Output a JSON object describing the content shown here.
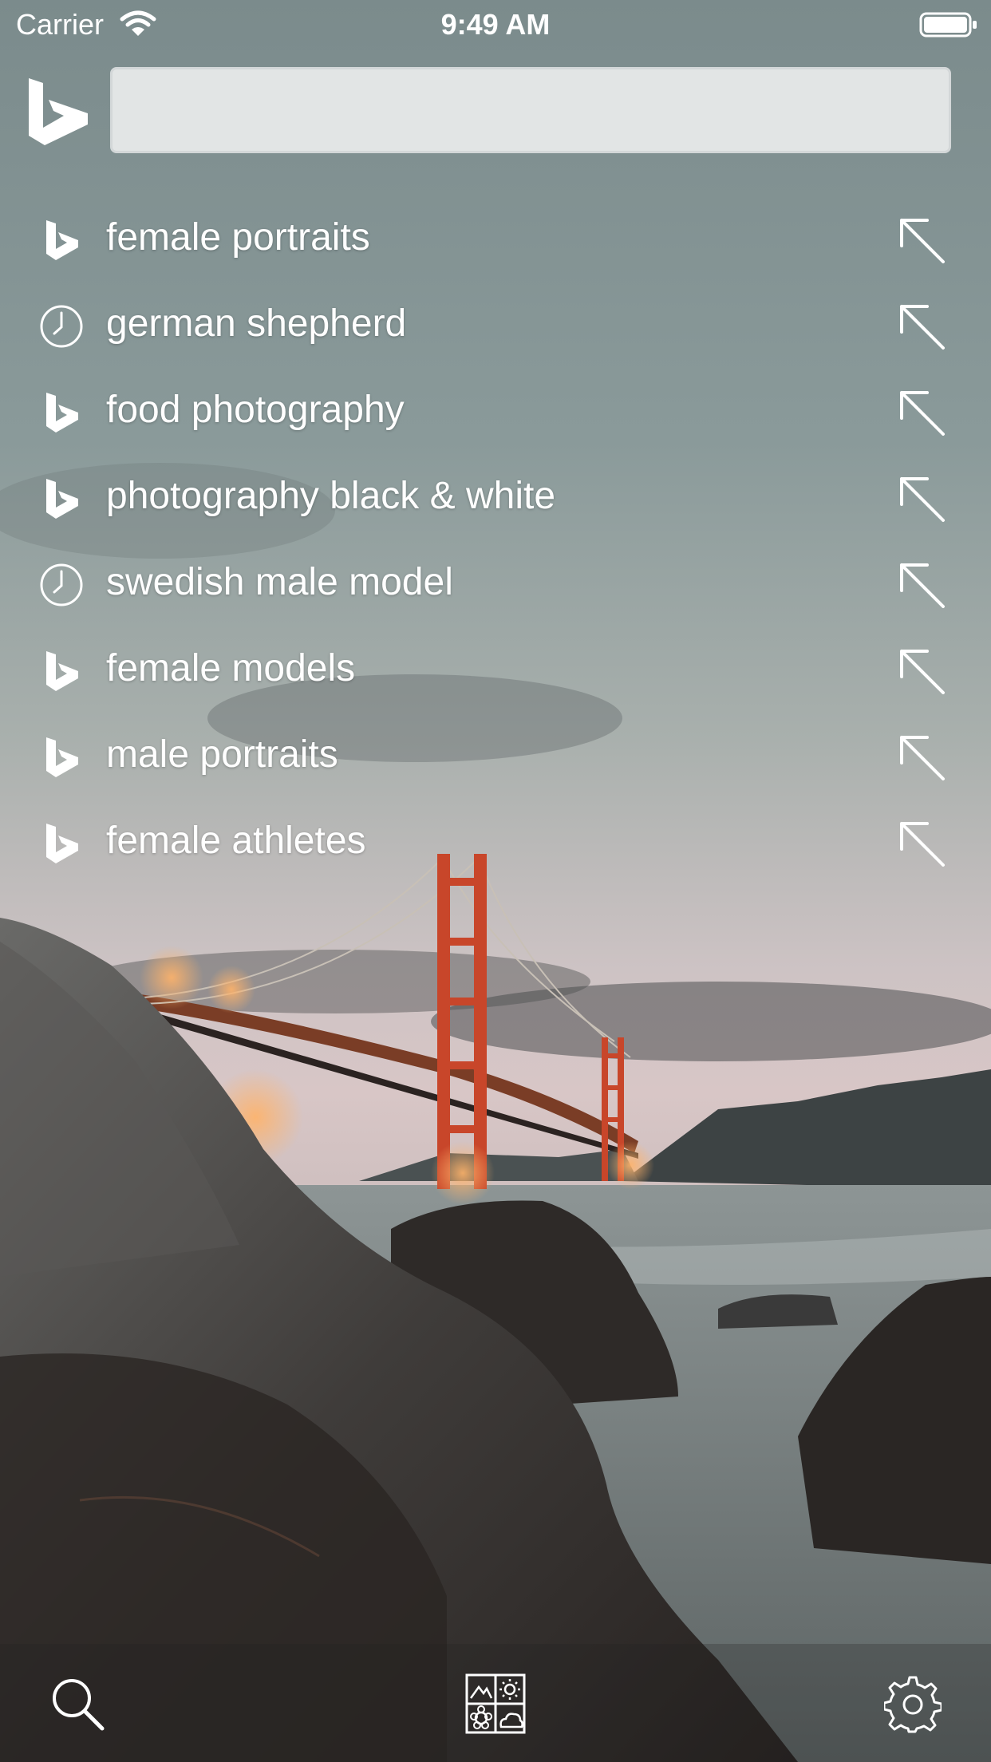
{
  "status_bar": {
    "carrier": "Carrier",
    "time": "9:49 AM"
  },
  "search": {
    "value": "",
    "placeholder": ""
  },
  "suggestions": [
    {
      "text": "female portraits",
      "icon": "bing-icon"
    },
    {
      "text": "german shepherd",
      "icon": "history-clock-icon"
    },
    {
      "text": "food photography",
      "icon": "bing-icon"
    },
    {
      "text": "photography black & white",
      "icon": "bing-icon"
    },
    {
      "text": "swedish male model",
      "icon": "history-clock-icon"
    },
    {
      "text": "female models",
      "icon": "bing-icon"
    },
    {
      "text": "male portraits",
      "icon": "bing-icon"
    },
    {
      "text": "female athletes",
      "icon": "bing-icon"
    }
  ],
  "tab_bar": {
    "icons": [
      "search-icon",
      "visual-search-icon",
      "settings-gear-icon"
    ]
  },
  "colors": {
    "text": "#ffffff",
    "search_field": "#e2e5e5",
    "bridge": "#c8462a"
  }
}
